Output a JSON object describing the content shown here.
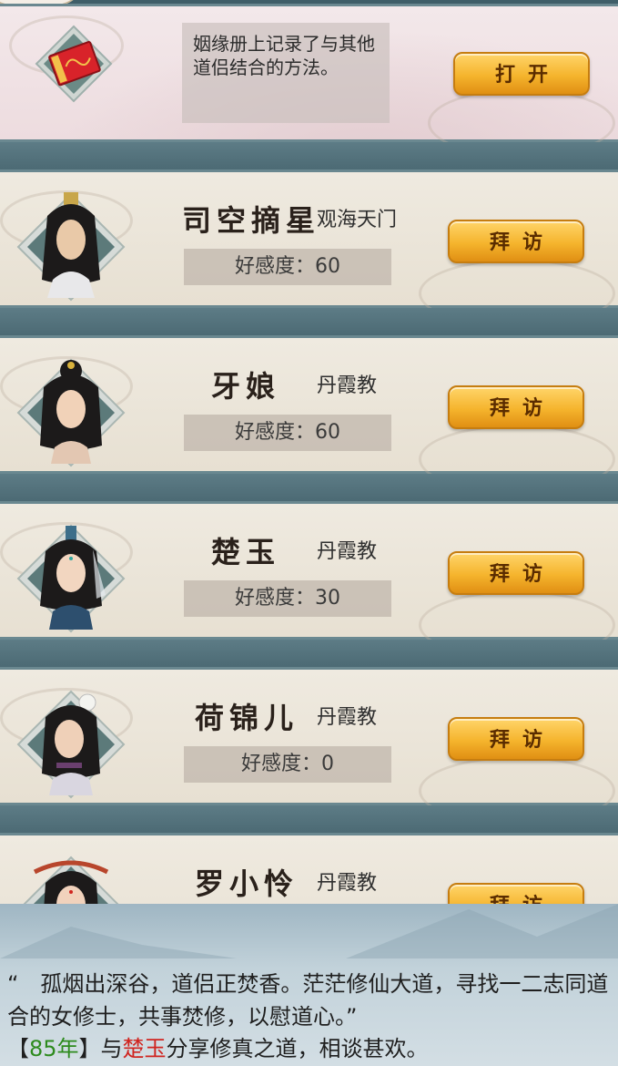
{
  "book": {
    "description": "姻缘册上记录了与其他道侣结合的方法。",
    "button_label": "打开"
  },
  "npcs": [
    {
      "name": "司空摘星",
      "sect": "观海天门",
      "favor": "好感度：60",
      "button_label": "拜访"
    },
    {
      "name": "牙娘",
      "sect": "丹霞教",
      "favor": "好感度：60",
      "button_label": "拜访"
    },
    {
      "name": "楚玉",
      "sect": "丹霞教",
      "favor": "好感度：30",
      "button_label": "拜访"
    },
    {
      "name": "荷锦儿",
      "sect": "丹霞教",
      "favor": "好感度：0",
      "button_label": "拜访"
    },
    {
      "name": "罗小怜",
      "sect": "丹霞教",
      "favor": "",
      "button_label": "拜访"
    }
  ],
  "bottom": {
    "poem": "“　孤烟出深谷，道侣正焚香。茫茫修仙大道，寻找一二志同道合的女修士，共事焚修，以慰道心。”",
    "log_open": "【",
    "log_year": "85年",
    "log_mid": "】与",
    "log_name": "楚玉",
    "log_tail": "分享修真之道，相谈甚欢。"
  },
  "colors": {
    "button_gold": "#f5b42d",
    "year_green": "#2e8b1e",
    "name_red": "#d0241f"
  }
}
